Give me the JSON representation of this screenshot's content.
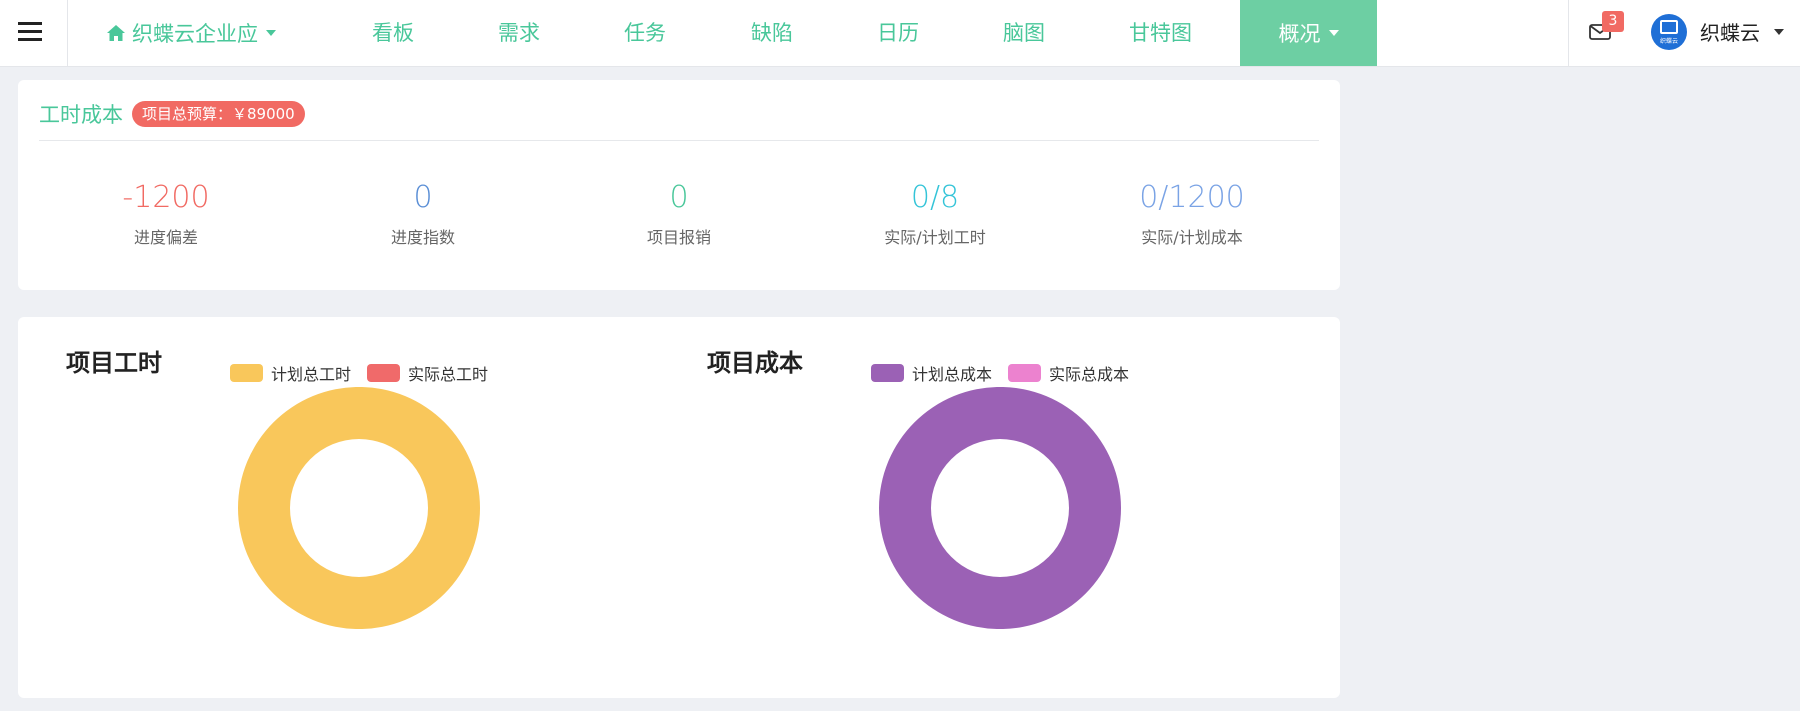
{
  "nav": {
    "project": {
      "label": "织蝶云企业应",
      "icon": "home-icon"
    },
    "items": [
      "看板",
      "需求",
      "任务",
      "缺陷",
      "日历",
      "脑图",
      "甘特图"
    ],
    "active": {
      "label": "概况"
    },
    "mail_badge": "3",
    "user": {
      "name": "织蝶云",
      "avatar_text": "织蝶云"
    }
  },
  "cost": {
    "title": "工时成本",
    "budget_badge": "项目总预算：￥89000",
    "metrics": [
      {
        "value": "-1200",
        "label": "进度偏差",
        "color": "#f16a63"
      },
      {
        "value": "0",
        "label": "进度指数",
        "color": "#5b8fd6"
      },
      {
        "value": "0",
        "label": "项目报销",
        "color": "#49c79a"
      },
      {
        "value": "0/8",
        "label": "实际/计划工时",
        "color": "#34c4d8"
      },
      {
        "value": "0/1200",
        "label": "实际/计划成本",
        "color": "#7aa3e5"
      }
    ]
  },
  "chart_data": [
    {
      "type": "pie",
      "title": "项目工时",
      "series": [
        {
          "name": "计划总工时",
          "value": 8,
          "color": "#f9c75b"
        },
        {
          "name": "实际总工时",
          "value": 0,
          "color": "#f06a6a"
        }
      ]
    },
    {
      "type": "pie",
      "title": "项目成本",
      "series": [
        {
          "name": "计划总成本",
          "value": 1200,
          "color": "#9b61b5"
        },
        {
          "name": "实际总成本",
          "value": 0,
          "color": "#ec82cf"
        }
      ]
    }
  ]
}
